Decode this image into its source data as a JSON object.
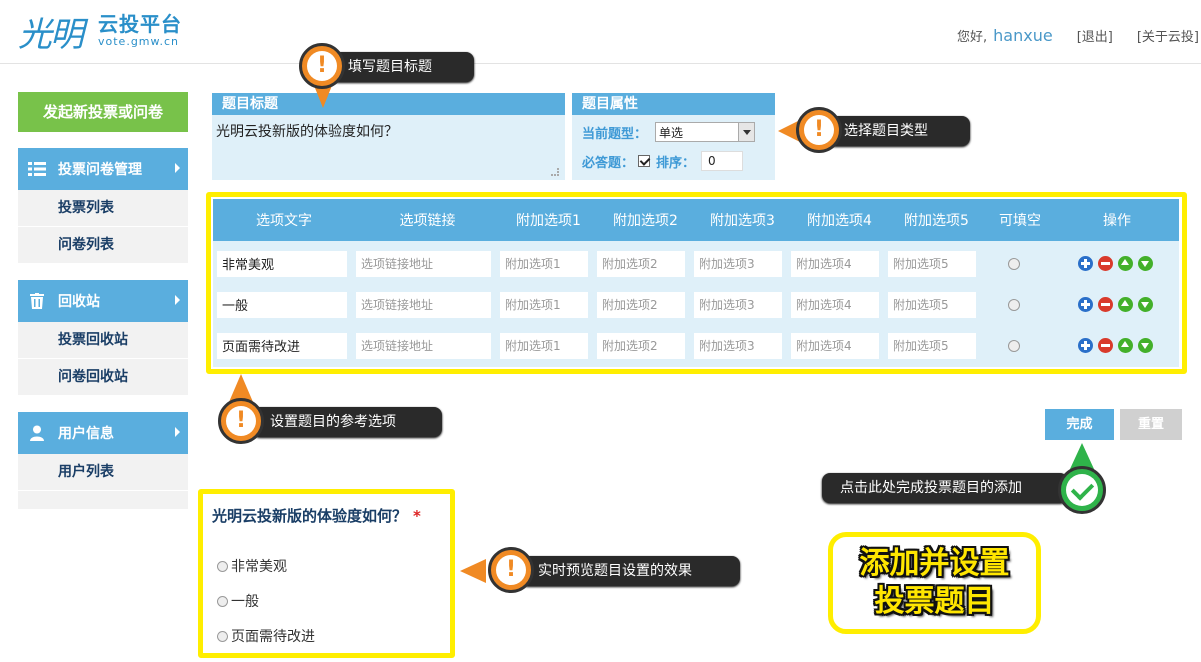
{
  "header": {
    "logo_brush": "光明",
    "logo_name": "云投平台",
    "logo_url": "vote.gmw.cn",
    "greeting": "您好,",
    "username": "hanxue",
    "logout": "[退出]",
    "about": "[关于云投]"
  },
  "sidebar": {
    "new_button": "发起新投票或问卷",
    "groups": [
      {
        "title": "投票问卷管理",
        "icon": "list-icon",
        "items": [
          "投票列表",
          "问卷列表"
        ]
      },
      {
        "title": "回收站",
        "icon": "trash-icon",
        "items": [
          "投票回收站",
          "问卷回收站"
        ]
      },
      {
        "title": "用户信息",
        "icon": "user-icon",
        "items": [
          "用户列表"
        ]
      }
    ]
  },
  "title_panel": {
    "heading": "题目标题",
    "value": "光明云投新版的体验度如何？"
  },
  "prop_panel": {
    "heading": "题目属性",
    "type_label": "当前题型：",
    "type_value": "单选",
    "required_label": "必答题：",
    "order_label": "排序：",
    "order_value": "0"
  },
  "table": {
    "headers": [
      "选项文字",
      "选项链接",
      "附加选项1",
      "附加选项2",
      "附加选项3",
      "附加选项4",
      "附加选项5",
      "可填空",
      "操作"
    ],
    "link_placeholder": "选项链接地址",
    "extra_placeholders": [
      "附加选项1",
      "附加选项2",
      "附加选项3",
      "附加选项4",
      "附加选项5"
    ],
    "rows": [
      "非常美观",
      "一般",
      "页面需待改进"
    ]
  },
  "actions": {
    "done": "完成",
    "reset": "重置"
  },
  "preview": {
    "question": "光明云投新版的体验度如何？",
    "required_mark": "*",
    "options": [
      "非常美观",
      "一般",
      "页面需待改进"
    ]
  },
  "callouts": {
    "fill_title": "填写题目标题",
    "choose_type": "选择题目类型",
    "set_options": "设置题目的参考选项",
    "click_done": "点击此处完成投票题目的添加",
    "live_preview": "实时预览题目设置的效果",
    "warn_mark": "!"
  },
  "big_label": {
    "line1": "添加并设置",
    "line2": "投票题目"
  },
  "colors": {
    "accent_blue": "#5aaede",
    "green_button": "#78c24a",
    "highlight_yellow": "#ffee00",
    "callout_orange": "#f08a24"
  }
}
